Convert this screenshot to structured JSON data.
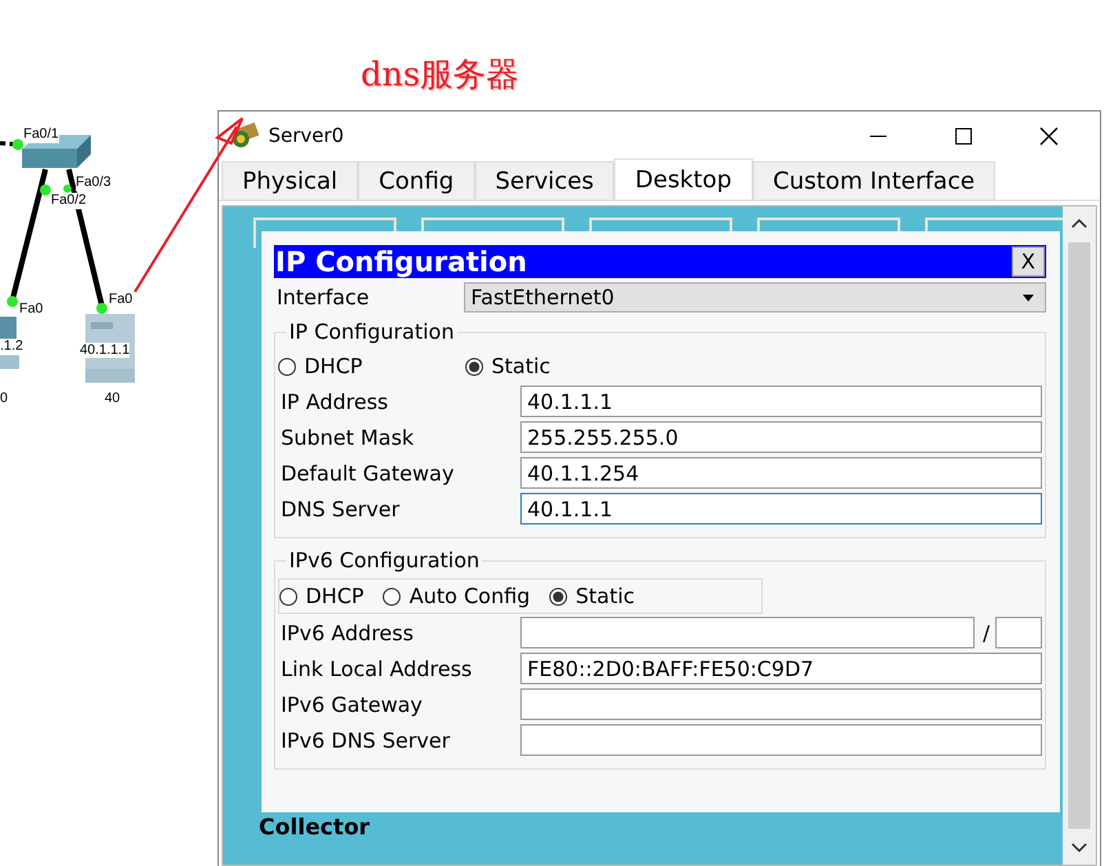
{
  "annotation": {
    "text": "dns服务器"
  },
  "topology": {
    "ports": [
      {
        "label": "Fa0/1"
      },
      {
        "label": "Fa0/3"
      },
      {
        "label": "Fa0/2"
      },
      {
        "label": "Fa0"
      },
      {
        "label": "Fa0"
      }
    ],
    "devices": [
      {
        "kind": "pc",
        "ip": ".1.2",
        "name": "0"
      },
      {
        "kind": "server",
        "ip": "40.1.1.1",
        "name": "40"
      }
    ]
  },
  "window": {
    "title": "Server0",
    "tabs": [
      {
        "label": "Physical",
        "selected": false
      },
      {
        "label": "Config",
        "selected": false
      },
      {
        "label": "Services",
        "selected": false
      },
      {
        "label": "Desktop",
        "selected": true
      },
      {
        "label": "Custom Interface",
        "selected": false
      }
    ],
    "desktop_caption": "Collector",
    "dialog": {
      "title": "IP Configuration",
      "close": "X",
      "interface_label": "Interface",
      "interface_value": "FastEthernet0",
      "ipv4": {
        "title": "IP Configuration",
        "modes": [
          {
            "label": "DHCP",
            "selected": false
          },
          {
            "label": "Static",
            "selected": true
          }
        ],
        "fields": [
          {
            "label": "IP Address",
            "value": "40.1.1.1",
            "focused": false
          },
          {
            "label": "Subnet Mask",
            "value": "255.255.255.0",
            "focused": false
          },
          {
            "label": "Default Gateway",
            "value": "40.1.1.254",
            "focused": false
          },
          {
            "label": "DNS Server",
            "value": "40.1.1.1",
            "focused": true
          }
        ]
      },
      "ipv6": {
        "title": "IPv6 Configuration",
        "modes": [
          {
            "label": "DHCP",
            "selected": false
          },
          {
            "label": "Auto Config",
            "selected": false
          },
          {
            "label": "Static",
            "selected": true
          }
        ],
        "address_label": "IPv6 Address",
        "slash": "/",
        "fields": [
          {
            "label": "Link Local Address",
            "value": "FE80::2D0:BAFF:FE50:C9D7"
          },
          {
            "label": "IPv6 Gateway"
          },
          {
            "label": "IPv6 DNS Server"
          }
        ]
      }
    }
  }
}
